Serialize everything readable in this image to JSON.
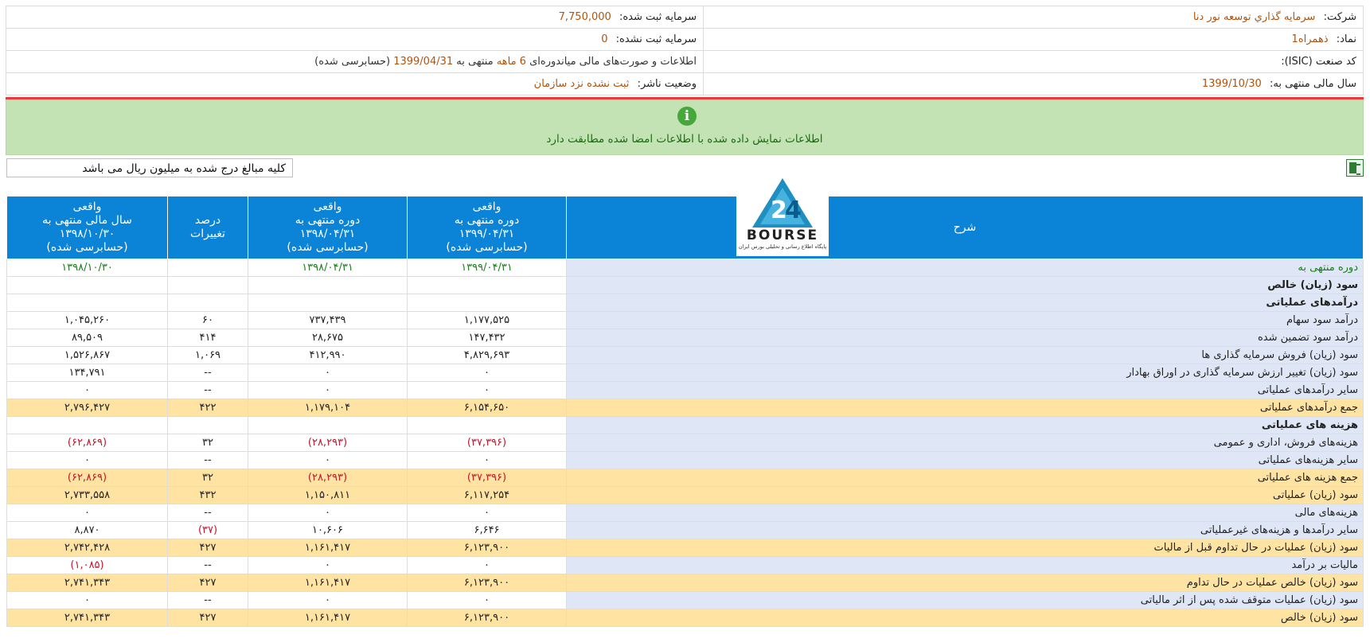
{
  "info": {
    "company_label": "شرکت:",
    "company_value": "سرمايه گذاري توسعه نور دنا",
    "registered_capital_label": "سرمایه ثبت شده:",
    "registered_capital_value": "7,750,000",
    "symbol_label": "نماد:",
    "symbol_value": "ذهمراه1",
    "unregistered_capital_label": "سرمایه ثبت نشده:",
    "unregistered_capital_value": "0",
    "isic_label": "کد صنعت (ISIC):",
    "isic_value": "",
    "report_prefix": "اطلاعات و صورت‌های مالی میاندوره‌ای",
    "report_months": "6 ماهه",
    "report_mid": "منتهی به",
    "report_date": "1399/04/31",
    "report_suffix": "(حسابرسی شده)",
    "fiscal_year_label": "سال مالی منتهی به:",
    "fiscal_year_value": "1399/10/30",
    "publisher_status_label": "وضعیت ناشر:",
    "publisher_status_value": "ثبت نشده نزد سازمان"
  },
  "notice": {
    "icon": "info-icon",
    "text": "اطلاعات نمایش داده شده با اطلاعات امضا شده مطابقت دارد"
  },
  "unit_note": "کلیه مبالغ درج شده به میلیون ریال می باشد",
  "logo": {
    "word": "BOURSE",
    "sub": "پایگاه اطلاع رسانی و تحلیلی بورس ایران"
  },
  "table": {
    "headers": {
      "desc": "شرح",
      "c1": [
        "واقعی",
        "دوره منتهی به",
        "۱۳۹۹/۰۴/۳۱",
        "(حسابرسی شده)"
      ],
      "c2": [
        "واقعی",
        "دوره منتهی به",
        "۱۳۹۸/۰۴/۳۱",
        "(حسابرسی شده)"
      ],
      "c3": [
        "درصد",
        "تغییرات"
      ],
      "c4": [
        "واقعی",
        "سال مالی منتهی به",
        "۱۳۹۸/۱۰/۳۰",
        "(حسابرسی شده)"
      ]
    },
    "rows": [
      {
        "desc": "دوره منتهی به",
        "v1": "۱۳۹۹/۰۴/۳۱",
        "v2": "۱۳۹۸/۰۴/۳۱",
        "chg": "",
        "v4": "۱۳۹۸/۱۰/۳۰",
        "style": "green"
      },
      {
        "desc": "سود (زیان) خالص",
        "v1": "",
        "v2": "",
        "chg": "",
        "v4": "",
        "style": "bold"
      },
      {
        "desc": "درآمدهای عملیاتی",
        "v1": "",
        "v2": "",
        "chg": "",
        "v4": "",
        "style": "bold"
      },
      {
        "desc": "درآمد سود سهام",
        "v1": "۱,۱۷۷,۵۲۵",
        "v2": "۷۳۷,۴۳۹",
        "chg": "۶۰",
        "v4": "۱,۰۴۵,۲۶۰",
        "style": ""
      },
      {
        "desc": "درآمد سود تضمین شده",
        "v1": "۱۴۷,۴۳۲",
        "v2": "۲۸,۶۷۵",
        "chg": "۴۱۴",
        "v4": "۸۹,۵۰۹",
        "style": ""
      },
      {
        "desc": "سود (زیان) فروش سرمایه گذاری ها",
        "v1": "۴,۸۲۹,۶۹۳",
        "v2": "۴۱۲,۹۹۰",
        "chg": "۱,۰۶۹",
        "v4": "۱,۵۲۶,۸۶۷",
        "style": ""
      },
      {
        "desc": "سود (زیان) تغییر ارزش سرمایه گذاری در اوراق بهادار",
        "v1": "۰",
        "v2": "۰",
        "chg": "--",
        "v4": "۱۳۴,۷۹۱",
        "style": ""
      },
      {
        "desc": "سایر درآمدهای عملیاتی",
        "v1": "۰",
        "v2": "۰",
        "chg": "--",
        "v4": "۰",
        "style": ""
      },
      {
        "desc": "جمع درآمدهای عملیاتی",
        "v1": "۶,۱۵۴,۶۵۰",
        "v2": "۱,۱۷۹,۱۰۴",
        "chg": "۴۲۲",
        "v4": "۲,۷۹۶,۴۲۷",
        "style": "hl"
      },
      {
        "desc": "هزینه های عملیاتی",
        "v1": "",
        "v2": "",
        "chg": "",
        "v4": "",
        "style": "bold"
      },
      {
        "desc": "هزینه‌های فروش، اداری و عمومی",
        "v1": "(۳۷,۳۹۶)",
        "v2": "(۲۸,۲۹۳)",
        "chg": "۳۲",
        "v4": "(۶۲,۸۶۹)",
        "style": "neg"
      },
      {
        "desc": "سایر هزینه‌های عملیاتی",
        "v1": "۰",
        "v2": "۰",
        "chg": "--",
        "v4": "۰",
        "style": ""
      },
      {
        "desc": "جمع هزینه های عملیاتی",
        "v1": "(۳۷,۳۹۶)",
        "v2": "(۲۸,۲۹۳)",
        "chg": "۳۲",
        "v4": "(۶۲,۸۶۹)",
        "style": "hl neg"
      },
      {
        "desc": "سود (زیان) عملیاتی",
        "v1": "۶,۱۱۷,۲۵۴",
        "v2": "۱,۱۵۰,۸۱۱",
        "chg": "۴۳۲",
        "v4": "۲,۷۳۳,۵۵۸",
        "style": "hl"
      },
      {
        "desc": "هزینه‌های مالی",
        "v1": "۰",
        "v2": "۰",
        "chg": "--",
        "v4": "۰",
        "style": ""
      },
      {
        "desc": "سایر درآمدها و هزینه‌های غیرعملیاتی",
        "v1": "۶,۶۴۶",
        "v2": "۱۰,۶۰۶",
        "chg": "(۳۷)",
        "v4": "۸,۸۷۰",
        "style": "negchg"
      },
      {
        "desc": "سود (زیان) عملیات در حال تداوم قبل از مالیات",
        "v1": "۶,۱۲۳,۹۰۰",
        "v2": "۱,۱۶۱,۴۱۷",
        "chg": "۴۲۷",
        "v4": "۲,۷۴۲,۴۲۸",
        "style": "hl"
      },
      {
        "desc": "مالیات بر درآمد",
        "v1": "۰",
        "v2": "۰",
        "chg": "--",
        "v4": "(۱,۰۸۵)",
        "style": "negv4"
      },
      {
        "desc": "سود (زیان) خالص عملیات در حال تداوم",
        "v1": "۶,۱۲۳,۹۰۰",
        "v2": "۱,۱۶۱,۴۱۷",
        "chg": "۴۲۷",
        "v4": "۲,۷۴۱,۳۴۳",
        "style": "hl"
      },
      {
        "desc": "سود (زیان) عملیات متوقف شده پس از اثر مالیاتی",
        "v1": "۰",
        "v2": "۰",
        "chg": "--",
        "v4": "۰",
        "style": ""
      },
      {
        "desc": "سود (زیان) خالص",
        "v1": "۶,۱۲۳,۹۰۰",
        "v2": "۱,۱۶۱,۴۱۷",
        "chg": "۴۲۷",
        "v4": "۲,۷۴۱,۳۴۳",
        "style": "hl"
      }
    ]
  }
}
